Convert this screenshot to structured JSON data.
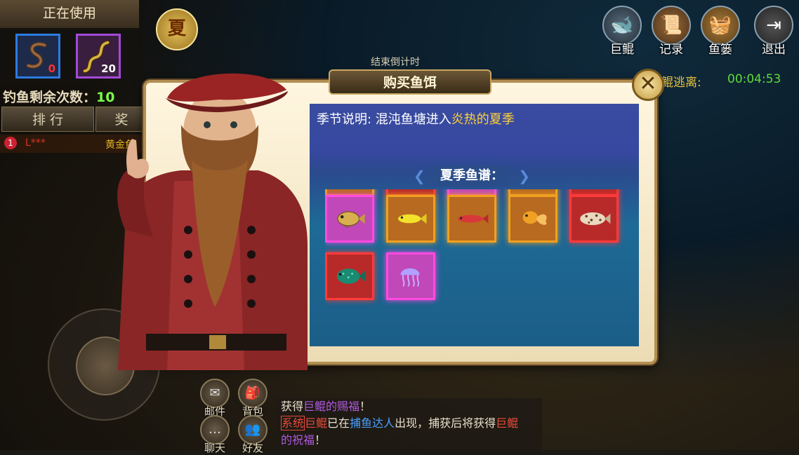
{
  "in_use": {
    "title": "正在使用",
    "slots": [
      {
        "icon": "worm-bait-icon",
        "count": "0",
        "border": "#2b7be0",
        "count_color": "#ff3030"
      },
      {
        "icon": "eel-bait-icon",
        "count": "20",
        "border": "#a34ad8",
        "count_color": "#ffffff"
      }
    ]
  },
  "fishing_remaining": {
    "label": "钓鱼剩余次数：",
    "value": "10"
  },
  "rank_tabs": [
    "排 行",
    "奖"
  ],
  "rank_row": {
    "index": "1",
    "name": "L***",
    "reward": "黄金鱼"
  },
  "season_badge": "夏",
  "countdown_label": "结束倒计时",
  "escape": {
    "label": "鲲逃离:",
    "time": "00:04:53"
  },
  "top_buttons": [
    {
      "label": "巨鲲",
      "icon": "whale-icon"
    },
    {
      "label": "记录",
      "icon": "record-icon"
    },
    {
      "label": "鱼篓",
      "icon": "fish-basket-icon"
    },
    {
      "label": "退出",
      "icon": "exit-icon"
    }
  ],
  "chat_buttons": [
    {
      "label": "邮件",
      "icon": "mail-icon"
    },
    {
      "label": "背包",
      "icon": "backpack-icon"
    },
    {
      "label": "聊天",
      "icon": "chat-icon"
    },
    {
      "label": "好友",
      "icon": "friends-icon"
    }
  ],
  "chat_log": {
    "line1": {
      "a": "获得",
      "b": "巨鲲的赐福",
      "c": "！"
    },
    "line2": {
      "tag": "系统",
      "a": "巨鲲",
      "b": "已在",
      "c": "捕鱼达人",
      "d": "出现，捕获后将获得",
      "e": "巨鲲"
    },
    "line3": {
      "a": "的祝福",
      "b": "！"
    }
  },
  "dialog": {
    "title": "购买鱼饵",
    "season_label": "季节说明: 混沌鱼塘进入",
    "season_highlight": "炎热的夏季",
    "catalog_title": "夏季鱼谱："
  },
  "fish_catalog": [
    {
      "fish": "puffer-fish",
      "rarity": "orange",
      "border": "#f0a020",
      "bg": "#b86a20"
    },
    {
      "fish": "puffer-fish",
      "rarity": "red",
      "border": "#ff3a3a",
      "bg": "#b82a2a"
    },
    {
      "fish": "puffer-fish",
      "rarity": "purple",
      "border": "#ff4ae0",
      "bg": "#c048b8"
    },
    {
      "fish": "puffer-fish",
      "rarity": "orange",
      "border": "#f0a020",
      "bg": "#b86a20"
    },
    {
      "fish": "puffer-fish",
      "rarity": "red",
      "border": "#ff3a3a",
      "bg": "#b82a2a"
    },
    {
      "fish": "puffer-fish",
      "rarity": "purple",
      "border": "#ff4ae0",
      "bg": "#c048b8"
    },
    {
      "fish": "yellow-fish",
      "rarity": "orange",
      "border": "#f0a020",
      "bg": "#b86a20"
    },
    {
      "fish": "red-minnow",
      "rarity": "orange",
      "border": "#f0a020",
      "bg": "#b86a20"
    },
    {
      "fish": "goldfish",
      "rarity": "orange",
      "border": "#f0a020",
      "bg": "#b86a20"
    },
    {
      "fish": "spotted-grouper",
      "rarity": "red",
      "border": "#ff3a3a",
      "bg": "#b82a2a"
    },
    {
      "fish": "green-reef-fish",
      "rarity": "red",
      "border": "#ff3a3a",
      "bg": "#b82a2a"
    },
    {
      "fish": "jellyfish",
      "rarity": "purple",
      "border": "#ff4ae0",
      "bg": "#c048b8"
    }
  ]
}
